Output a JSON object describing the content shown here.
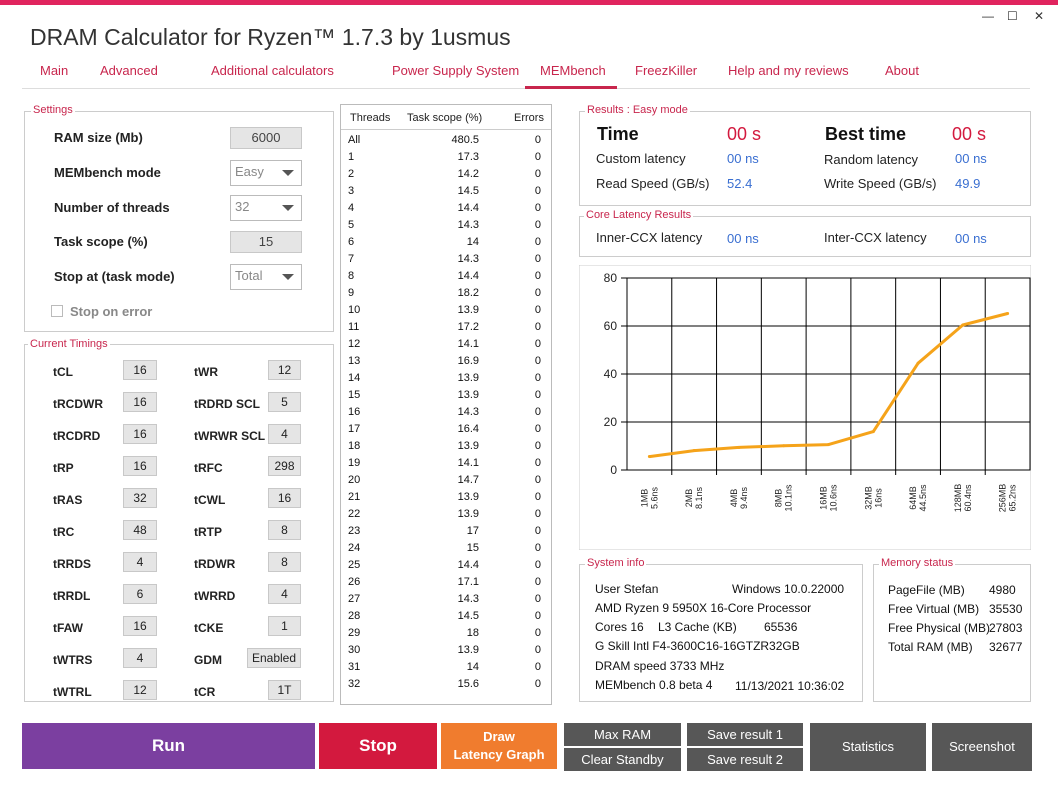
{
  "app": {
    "title": "DRAM Calculator for Ryzen™ 1.7.3 by 1usmus",
    "window_controls": {
      "minimize": "—",
      "maximize": "☐",
      "close": "✕"
    }
  },
  "nav": [
    {
      "label": "Main"
    },
    {
      "label": "Advanced"
    },
    {
      "label": "Additional calculators"
    },
    {
      "label": "Power Supply System"
    },
    {
      "label": "MEMbench"
    },
    {
      "label": "FreezKiller"
    },
    {
      "label": "Help and my reviews"
    },
    {
      "label": "About"
    }
  ],
  "settings": {
    "title": "Settings",
    "ram_size_label": "RAM size (Mb)",
    "ram_size_value": "6000",
    "mode_label": "MEMbench mode",
    "mode_value": "Easy",
    "threads_label": "Number of threads",
    "threads_value": "32",
    "scope_label": "Task scope (%)",
    "scope_value": "15",
    "stop_label": "Stop at (task mode)",
    "stop_value": "Total",
    "stop_on_error_label": "Stop on error"
  },
  "timings": {
    "title": "Current Timings",
    "left": [
      {
        "name": "tCL",
        "value": "16"
      },
      {
        "name": "tRCDWR",
        "value": "16"
      },
      {
        "name": "tRCDRD",
        "value": "16"
      },
      {
        "name": "tRP",
        "value": "16"
      },
      {
        "name": "tRAS",
        "value": "32"
      },
      {
        "name": "tRC",
        "value": "48"
      },
      {
        "name": "tRRDS",
        "value": "4"
      },
      {
        "name": "tRRDL",
        "value": "6"
      },
      {
        "name": "tFAW",
        "value": "16"
      },
      {
        "name": "tWTRS",
        "value": "4"
      },
      {
        "name": "tWTRL",
        "value": "12"
      }
    ],
    "right": [
      {
        "name": "tWR",
        "value": "12"
      },
      {
        "name": "tRDRD SCL",
        "value": "5"
      },
      {
        "name": "tWRWR SCL",
        "value": "4"
      },
      {
        "name": "tRFC",
        "value": "298"
      },
      {
        "name": "tCWL",
        "value": "16"
      },
      {
        "name": "tRTP",
        "value": "8"
      },
      {
        "name": "tRDWR",
        "value": "8"
      },
      {
        "name": "tWRRD",
        "value": "4"
      },
      {
        "name": "tCKE",
        "value": "1"
      },
      {
        "name": "GDM",
        "value": "Enabled"
      },
      {
        "name": "tCR",
        "value": "1T"
      }
    ]
  },
  "threads_table": {
    "headers": [
      "Threads",
      "Task scope (%)",
      "Errors"
    ],
    "rows": [
      [
        "All",
        "480.5",
        "0"
      ],
      [
        "1",
        "17.3",
        "0"
      ],
      [
        "2",
        "14.2",
        "0"
      ],
      [
        "3",
        "14.5",
        "0"
      ],
      [
        "4",
        "14.4",
        "0"
      ],
      [
        "5",
        "14.3",
        "0"
      ],
      [
        "6",
        "14",
        "0"
      ],
      [
        "7",
        "14.3",
        "0"
      ],
      [
        "8",
        "14.4",
        "0"
      ],
      [
        "9",
        "18.2",
        "0"
      ],
      [
        "10",
        "13.9",
        "0"
      ],
      [
        "11",
        "17.2",
        "0"
      ],
      [
        "12",
        "14.1",
        "0"
      ],
      [
        "13",
        "16.9",
        "0"
      ],
      [
        "14",
        "13.9",
        "0"
      ],
      [
        "15",
        "13.9",
        "0"
      ],
      [
        "16",
        "14.3",
        "0"
      ],
      [
        "17",
        "16.4",
        "0"
      ],
      [
        "18",
        "13.9",
        "0"
      ],
      [
        "19",
        "14.1",
        "0"
      ],
      [
        "20",
        "14.7",
        "0"
      ],
      [
        "21",
        "13.9",
        "0"
      ],
      [
        "22",
        "13.9",
        "0"
      ],
      [
        "23",
        "17",
        "0"
      ],
      [
        "24",
        "15",
        "0"
      ],
      [
        "25",
        "14.4",
        "0"
      ],
      [
        "26",
        "17.1",
        "0"
      ],
      [
        "27",
        "14.3",
        "0"
      ],
      [
        "28",
        "14.5",
        "0"
      ],
      [
        "29",
        "18",
        "0"
      ],
      [
        "30",
        "13.9",
        "0"
      ],
      [
        "31",
        "14",
        "0"
      ],
      [
        "32",
        "15.6",
        "0"
      ]
    ]
  },
  "results": {
    "title": "Results : Easy mode",
    "time_label": "Time",
    "time_value": "00 s",
    "best_time_label": "Best time",
    "best_time_value": "00 s",
    "custom_latency_label": "Custom latency",
    "custom_latency_value": "00 ns",
    "random_latency_label": "Random latency",
    "random_latency_value": "00 ns",
    "read_speed_label": "Read Speed (GB/s)",
    "read_speed_value": "52.4",
    "write_speed_label": "Write Speed (GB/s)",
    "write_speed_value": "49.9"
  },
  "core_latency": {
    "title": "Core Latency Results",
    "inner_label": "Inner-CCX latency",
    "inner_value": "00 ns",
    "inter_label": "Inter-CCX latency",
    "inter_value": "00 ns"
  },
  "chart_data": {
    "type": "line",
    "categories": [
      "1MB 5.6ns",
      "2MB 8.1ns",
      "4MB 9.4ns",
      "8MB 10.1ns",
      "16MB 10.6ns",
      "32MB 16ns",
      "64MB 44.5ns",
      "128MB 60.4ns",
      "256MB 65.2ns"
    ],
    "category_sizes": [
      "1MB",
      "2MB",
      "4MB",
      "8MB",
      "16MB",
      "32MB",
      "64MB",
      "128MB",
      "256MB"
    ],
    "category_latencies": [
      "5.6ns",
      "8.1ns",
      "9.4ns",
      "10.1ns",
      "10.6ns",
      "16ns",
      "44.5ns",
      "60.4ns",
      "65.2ns"
    ],
    "values": [
      5.6,
      8.1,
      9.4,
      10.1,
      10.6,
      16,
      44.5,
      60.4,
      65.2
    ],
    "ylim": [
      0,
      80
    ],
    "yticks": [
      0,
      20,
      40,
      60,
      80
    ],
    "grid": true,
    "line_color": "#f5a31a",
    "title": "",
    "xlabel": "",
    "ylabel": ""
  },
  "system_info": {
    "title": "System info",
    "user": "User Stefan",
    "os": "Windows 10.0.22000",
    "cpu": "AMD Ryzen 9 5950X 16-Core Processor",
    "cores": "Cores 16",
    "l3_label": "L3 Cache (KB)",
    "l3_value": "65536",
    "memory_kit": "G Skill Intl F4-3600C16-16GTZR32GB",
    "dram_speed": "DRAM speed 3733 MHz",
    "membench": "MEMbench 0.8 beta 4",
    "date": "11/13/2021 10:36:02"
  },
  "memory_status": {
    "title": "Memory status",
    "rows": [
      {
        "label": "PageFile (MB)",
        "value": "4980"
      },
      {
        "label": "Free Virtual (MB)",
        "value": "35530"
      },
      {
        "label": "Free Physical (MB)",
        "value": "27803"
      },
      {
        "label": "Total RAM (MB)",
        "value": "32677"
      }
    ]
  },
  "buttons": {
    "run": "Run",
    "stop": "Stop",
    "draw_line1": "Draw",
    "draw_line2": "Latency Graph",
    "max_ram": "Max RAM",
    "clear_standby": "Clear Standby",
    "save1": "Save result 1",
    "save2": "Save result 2",
    "statistics": "Statistics",
    "screenshot": "Screenshot"
  },
  "colors": {
    "accent": "#c8264d",
    "run": "#7b3fa0",
    "stop": "#d3193e",
    "draw": "#f07c2e",
    "gray_button": "#575757",
    "value_blue": "#3a6fd1"
  }
}
